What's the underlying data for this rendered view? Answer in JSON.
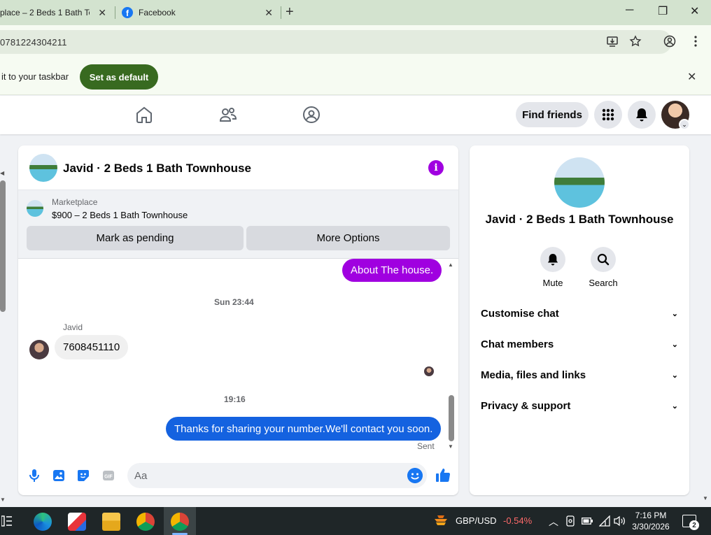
{
  "browser": {
    "tabs": [
      {
        "label": "place – 2 Beds 1 Bath Townhouse",
        "close": "✕"
      },
      {
        "label": "Facebook",
        "close": "✕"
      }
    ],
    "new_tab": "+",
    "window_controls": {
      "minimize": "─",
      "restore": "❐",
      "close": "✕"
    },
    "url": "0781224304211"
  },
  "infobar": {
    "text": "it to your taskbar",
    "button": "Set as default",
    "close": "✕"
  },
  "fb_nav": {
    "find_friends": "Find friends"
  },
  "chat": {
    "title": "Javid · 2 Beds 1 Bath Townhouse",
    "info_glyph": "i",
    "marketplace": {
      "label": "Marketplace",
      "item": "$900 – 2 Beds 1 Bath Townhouse",
      "mark_pending": "Mark as pending",
      "more_options": "More Options"
    },
    "messages": {
      "m1": "About The house.",
      "ts1": "Sun 23:44",
      "sender": "Javid",
      "m2": "7608451110",
      "ts2": "19:16",
      "m3": "Thanks for sharing your number.We'll contact you soon.",
      "status": "Sent"
    },
    "composer": {
      "placeholder": "Aa"
    }
  },
  "side": {
    "name": "Javid · 2 Beds 1 Bath Townhouse",
    "mute": "Mute",
    "search": "Search",
    "rows": [
      "Customise chat",
      "Chat members",
      "Media, files and links",
      "Privacy & support"
    ],
    "chevron": "⌄"
  },
  "taskbar": {
    "ticker": "GBP/USD",
    "change": "-0.54%",
    "time": "7:16 PM",
    "date": "3/30/2026",
    "notifications": "2"
  },
  "colors": {
    "messenger_purple": "#a000e0",
    "messenger_blue": "#1462e0",
    "set_default_green": "#386a20"
  }
}
